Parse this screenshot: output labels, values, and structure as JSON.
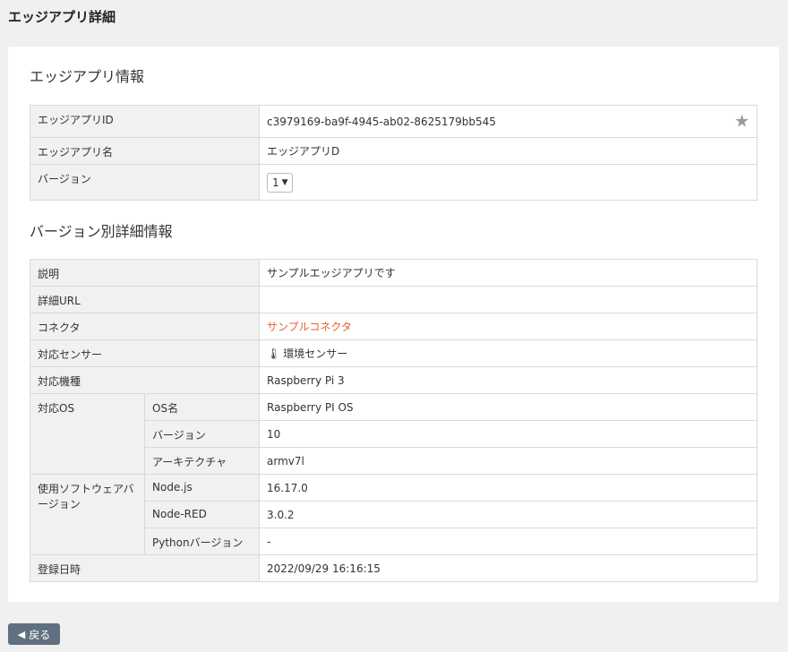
{
  "page_title": "エッジアプリ詳細",
  "app_info": {
    "heading": "エッジアプリ情報",
    "id_label": "エッジアプリID",
    "id_value": "c3979169-ba9f-4945-ab02-8625179bb545",
    "star_icon": "star-icon",
    "name_label": "エッジアプリ名",
    "name_value": "エッジアプリD",
    "version_label": "バージョン",
    "version_selected": "1"
  },
  "version_details": {
    "heading": "バージョン別詳細情報",
    "description_label": "説明",
    "description_value": "サンプルエッジアプリです",
    "url_label": "詳細URL",
    "url_value": "",
    "connector_label": "コネクタ",
    "connector_value": "サンプルコネクタ",
    "sensor_label": "対応センサー",
    "sensor_value": "環境センサー",
    "model_label": "対応機種",
    "model_value": "Raspberry Pi 3",
    "os_label": "対応OS",
    "os_name_label": "OS名",
    "os_name_value": "Raspberry PI OS",
    "os_version_label": "バージョン",
    "os_version_value": "10",
    "os_arch_label": "アーキテクチャ",
    "os_arch_value": "armv7l",
    "software_label": "使用ソフトウェアバージョン",
    "node_label": "Node.js",
    "node_value": "16.17.0",
    "nodered_label": "Node-RED",
    "nodered_value": "3.0.2",
    "python_label": "Pythonバージョン",
    "python_value": "-",
    "registered_label": "登録日時",
    "registered_value": "2022/09/29 16:16:15"
  },
  "back_button": "戻る",
  "colors": {
    "link": "#e8612c",
    "button_bg": "#607080",
    "label_bg": "#f1f1f1"
  }
}
